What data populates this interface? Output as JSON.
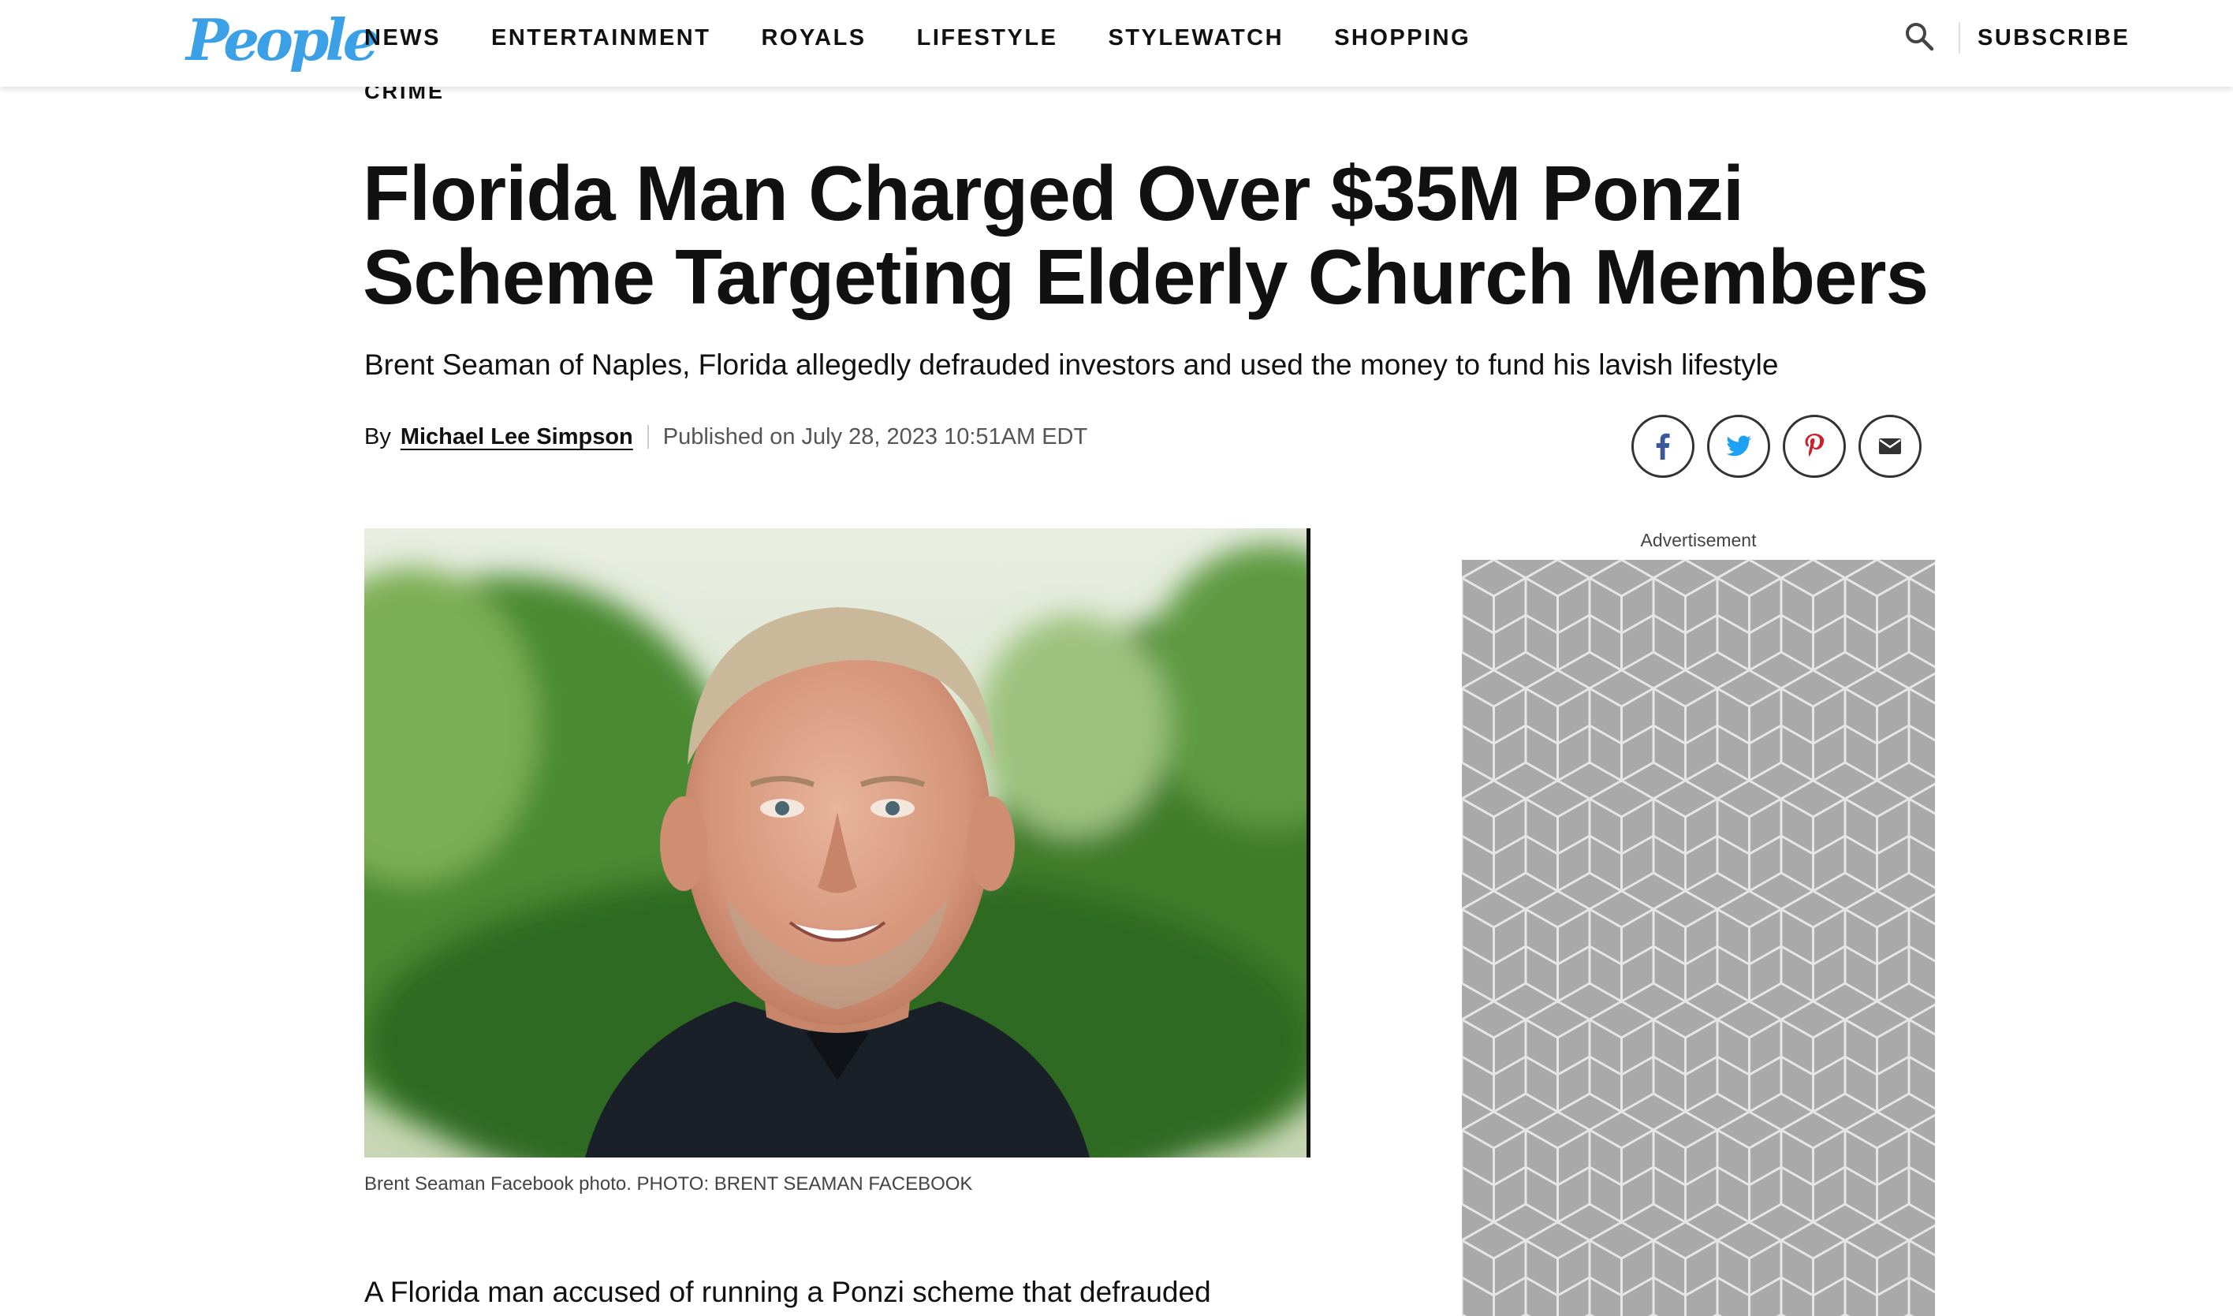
{
  "header": {
    "logo": "People",
    "nav": [
      "NEWS",
      "ENTERTAINMENT",
      "ROYALS",
      "LIFESTYLE",
      "STYLEWATCH",
      "SHOPPING"
    ],
    "subscribe": "SUBSCRIBE",
    "search_icon": "search-icon"
  },
  "article": {
    "category": "CRIME",
    "headline": "Florida Man Charged Over $35M Ponzi Scheme Targeting Elderly Church Members",
    "subheadline": "Brent Seaman of Naples, Florida allegedly defrauded investors and used the money to fund his lavish lifestyle",
    "byline_prefix": "By",
    "author": "Michael Lee Simpson",
    "published": "Published on July 28, 2023 10:51AM EDT",
    "photo_caption": "Brent Seaman Facebook photo. PHOTO: BRENT SEAMAN FACEBOOK",
    "body_first_line": "A Florida man accused of running a Ponzi scheme that defrauded dozens"
  },
  "social": {
    "icons": [
      "facebook-icon",
      "twitter-icon",
      "pinterest-icon",
      "email-icon"
    ]
  },
  "ad": {
    "label": "Advertisement"
  },
  "colors": {
    "brand": "#3ba0e6",
    "facebook": "#3b5998",
    "twitter": "#1da1f2",
    "pinterest": "#c8232c",
    "ad_gray": "#a9a9a9"
  }
}
